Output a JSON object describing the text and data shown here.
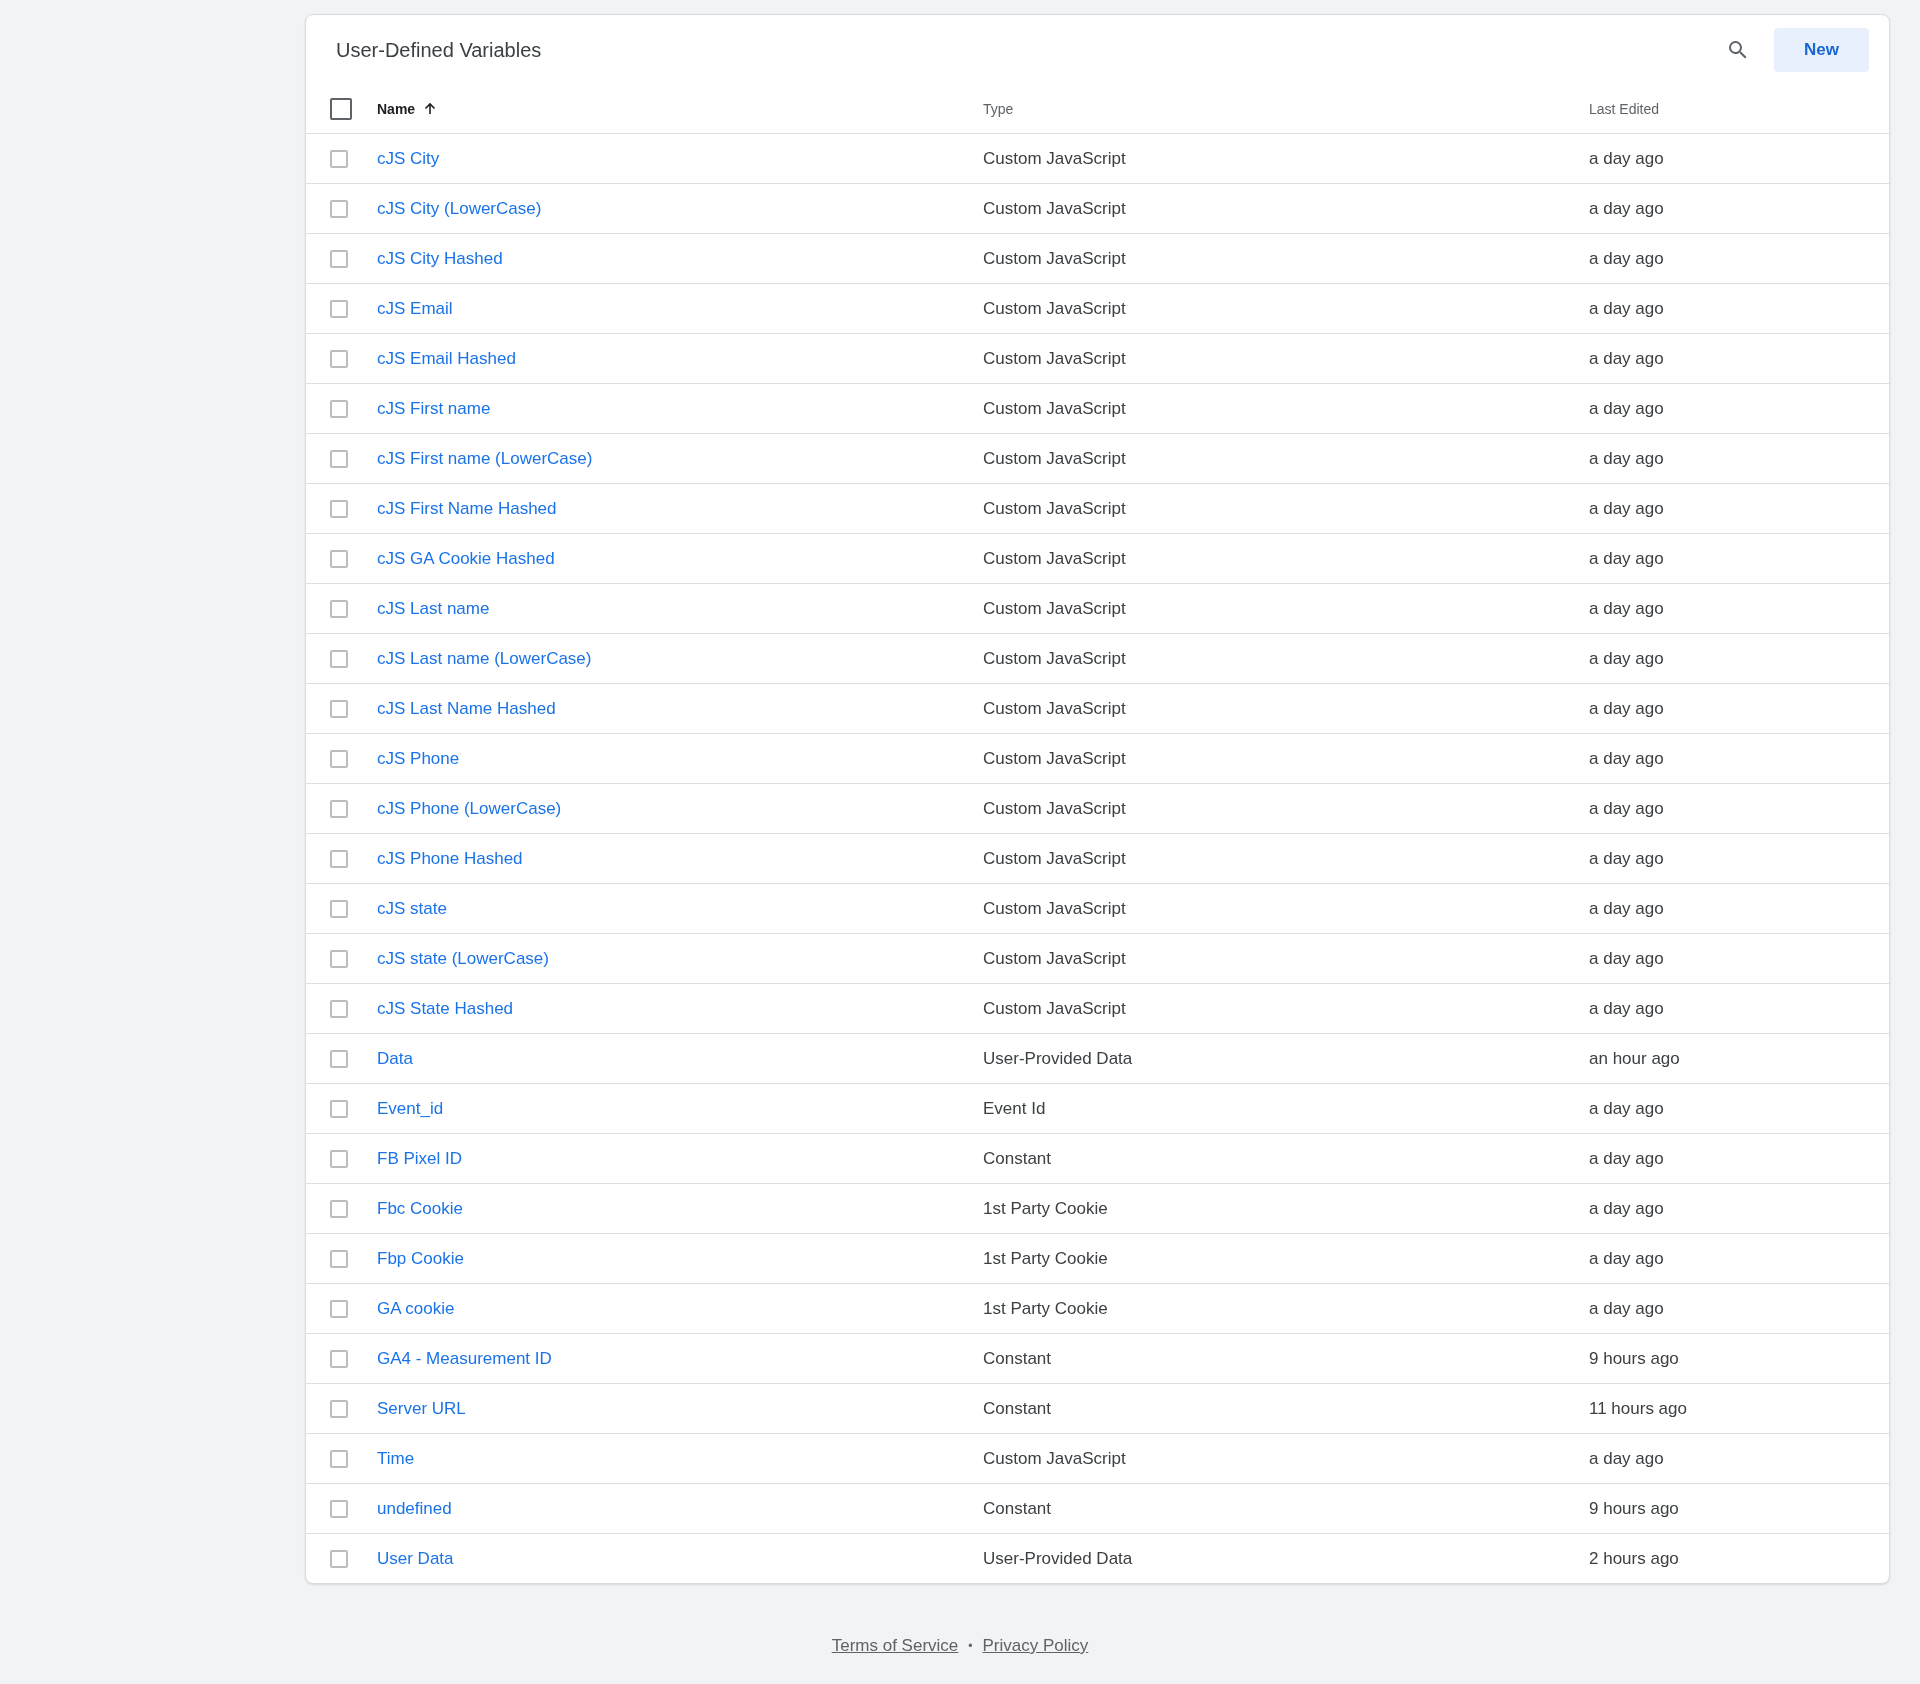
{
  "panel": {
    "title": "User-Defined Variables",
    "new_button": "New"
  },
  "table": {
    "select_all": {
      "checked": false
    },
    "columns": [
      {
        "label": "Name",
        "sorted": true
      },
      {
        "label": "Type",
        "sorted": false
      },
      {
        "label": "Last Edited",
        "sorted": false
      }
    ],
    "rows": [
      {
        "name": "cJS City",
        "type": "Custom JavaScript",
        "last_edited": "a day ago",
        "checked": false
      },
      {
        "name": "cJS City (LowerCase)",
        "type": "Custom JavaScript",
        "last_edited": "a day ago",
        "checked": false
      },
      {
        "name": "cJS City Hashed",
        "type": "Custom JavaScript",
        "last_edited": "a day ago",
        "checked": false
      },
      {
        "name": "cJS Email",
        "type": "Custom JavaScript",
        "last_edited": "a day ago",
        "checked": false
      },
      {
        "name": "cJS Email Hashed",
        "type": "Custom JavaScript",
        "last_edited": "a day ago",
        "checked": false
      },
      {
        "name": "cJS First name",
        "type": "Custom JavaScript",
        "last_edited": "a day ago",
        "checked": false
      },
      {
        "name": "cJS First name (LowerCase)",
        "type": "Custom JavaScript",
        "last_edited": "a day ago",
        "checked": false
      },
      {
        "name": "cJS First Name Hashed",
        "type": "Custom JavaScript",
        "last_edited": "a day ago",
        "checked": false
      },
      {
        "name": "cJS GA Cookie Hashed",
        "type": "Custom JavaScript",
        "last_edited": "a day ago",
        "checked": false
      },
      {
        "name": "cJS Last name",
        "type": "Custom JavaScript",
        "last_edited": "a day ago",
        "checked": false
      },
      {
        "name": "cJS Last name (LowerCase)",
        "type": "Custom JavaScript",
        "last_edited": "a day ago",
        "checked": false
      },
      {
        "name": "cJS Last Name Hashed",
        "type": "Custom JavaScript",
        "last_edited": "a day ago",
        "checked": false
      },
      {
        "name": "cJS Phone",
        "type": "Custom JavaScript",
        "last_edited": "a day ago",
        "checked": false
      },
      {
        "name": "cJS Phone (LowerCase)",
        "type": "Custom JavaScript",
        "last_edited": "a day ago",
        "checked": false
      },
      {
        "name": "cJS Phone Hashed",
        "type": "Custom JavaScript",
        "last_edited": "a day ago",
        "checked": false
      },
      {
        "name": "cJS state",
        "type": "Custom JavaScript",
        "last_edited": "a day ago",
        "checked": false
      },
      {
        "name": "cJS state (LowerCase)",
        "type": "Custom JavaScript",
        "last_edited": "a day ago",
        "checked": false
      },
      {
        "name": "cJS State Hashed",
        "type": "Custom JavaScript",
        "last_edited": "a day ago",
        "checked": false
      },
      {
        "name": "Data",
        "type": "User-Provided Data",
        "last_edited": "an hour ago",
        "checked": false
      },
      {
        "name": "Event_id",
        "type": "Event Id",
        "last_edited": "a day ago",
        "checked": false
      },
      {
        "name": "FB Pixel ID",
        "type": "Constant",
        "last_edited": "a day ago",
        "checked": false
      },
      {
        "name": "Fbc Cookie",
        "type": "1st Party Cookie",
        "last_edited": "a day ago",
        "checked": false
      },
      {
        "name": "Fbp Cookie",
        "type": "1st Party Cookie",
        "last_edited": "a day ago",
        "checked": false
      },
      {
        "name": "GA cookie",
        "type": "1st Party Cookie",
        "last_edited": "a day ago",
        "checked": false
      },
      {
        "name": "GA4 - Measurement ID",
        "type": "Constant",
        "last_edited": "9 hours ago",
        "checked": false
      },
      {
        "name": "Server URL",
        "type": "Constant",
        "last_edited": "11 hours ago",
        "checked": false
      },
      {
        "name": "Time",
        "type": "Custom JavaScript",
        "last_edited": "a day ago",
        "checked": false
      },
      {
        "name": "undefined",
        "type": "Constant",
        "last_edited": "9 hours ago",
        "checked": false
      },
      {
        "name": "User Data",
        "type": "User-Provided Data",
        "last_edited": "2 hours ago",
        "checked": false
      }
    ]
  },
  "footer": {
    "links": [
      "Terms of Service",
      "Privacy Policy"
    ],
    "separator": "•"
  }
}
